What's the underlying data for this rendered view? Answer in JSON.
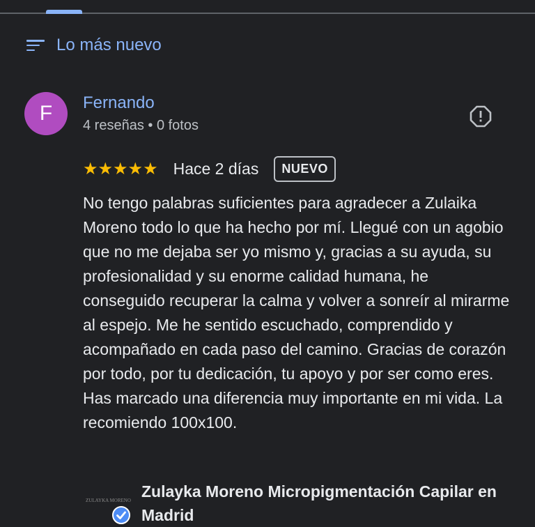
{
  "sort": {
    "label": "Lo más nuevo"
  },
  "review": {
    "avatar_letter": "F",
    "avatar_color": "#b04cc0",
    "author": "Fernando",
    "meta": "4 reseñas • 0 fotos",
    "stars": "★★★★★",
    "rating": 5,
    "date": "Hace 2 días",
    "badge": "NUEVO",
    "text": "No tengo palabras suficientes para agradecer a Zulaika Moreno todo lo que ha hecho por mí. Llegué con un agobio que no me dejaba ser yo mismo y, gracias a su ayuda, su profesionalidad y su enorme calidad humana, he conseguido recuperar la calma y volver a sonreír al mirarme al espejo. Me he sentido escuchado, comprendido y acompañado en cada paso del camino. Gracias de corazón por todo, por tu dedicación, tu apoyo y por ser como eres. Has marcado una diferencia muy importante en mi vida. La recomiendo 100x100."
  },
  "owner": {
    "name": "Zulayka Moreno Micropigmentación Capilar en Madrid",
    "logo_text": "ZULAYKA MORENO"
  },
  "colors": {
    "accent": "#8ab4f8",
    "star": "#fbbc04",
    "background": "#202124"
  }
}
